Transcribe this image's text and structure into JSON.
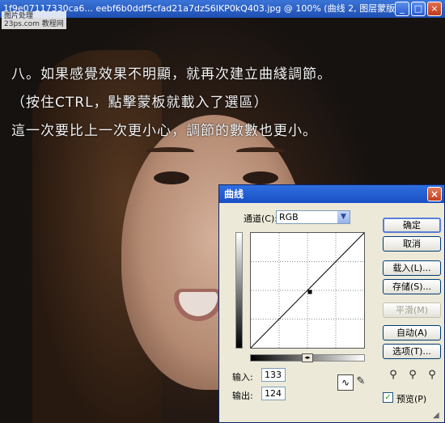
{
  "document": {
    "title": "1f9e07117330ca6... eebf6b0ddf5cfad21a7dzS6IKP0kQ403.jpg @ 100% (曲线 2, 图层蒙版...",
    "minimize": "_",
    "maximize": "□",
    "close": "×"
  },
  "watermark": {
    "line1": "图片处理",
    "line2": "23ps.com 教程网"
  },
  "overlay_text": {
    "line1": "八。如果感覺效果不明顯，就再次建立曲綫調節。",
    "line2": "（按住CTRL，點擊蒙板就載入了選區）",
    "line3": "這一次要比上一次更小心，調節的數數也更小。"
  },
  "curves_dialog": {
    "title": "曲线",
    "close": "×",
    "channel_label": "通道(C):",
    "channel_value": "RGB",
    "buttons": {
      "ok": "确定",
      "cancel": "取消",
      "load": "载入(L)...",
      "save": "存储(S)...",
      "smooth": "平滑(M)",
      "auto": "自动(A)",
      "options": "选项(T)..."
    },
    "input_label": "输入:",
    "input_value": "133",
    "output_label": "输出:",
    "output_value": "124",
    "preview_label": "预览(P)",
    "preview_checked": true,
    "curve_point": {
      "input": 133,
      "output": 124
    }
  }
}
